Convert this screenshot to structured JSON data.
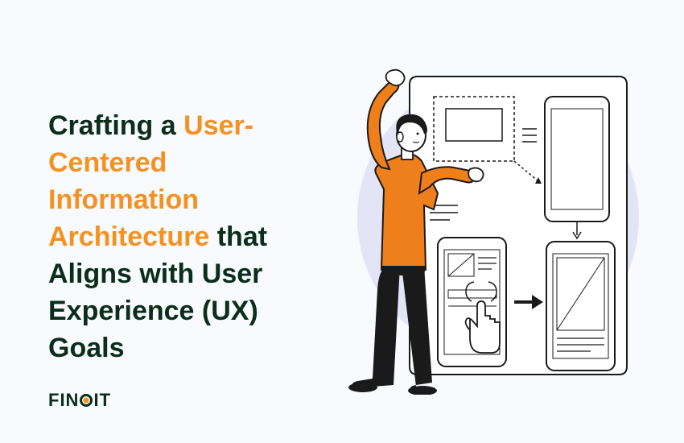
{
  "heading": {
    "part1": "Crafting a",
    "highlight": "User-Centered Information Architecture",
    "part2": "that Aligns with User Experience (UX) Goals"
  },
  "logo": {
    "text_before": "FIN",
    "text_after": "IT"
  },
  "colors": {
    "headline_dark": "#0a2e1a",
    "highlight_orange": "#f59120",
    "background": "#f8fafd",
    "illustration_lavender": "#e3e4f5",
    "illustration_stroke": "#1a1a1a",
    "person_shirt": "#ef7f1a"
  }
}
